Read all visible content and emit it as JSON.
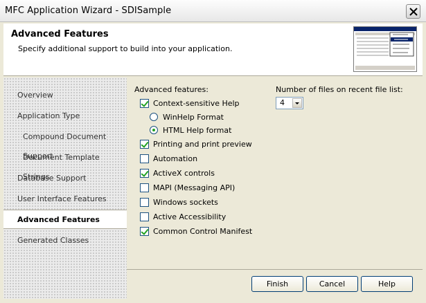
{
  "window": {
    "title": "MFC Application Wizard - SDISample"
  },
  "header": {
    "title": "Advanced Features",
    "subtitle": "Specify additional support to build into your application."
  },
  "nav": {
    "items": [
      {
        "label": "Overview"
      },
      {
        "label": "Application Type"
      },
      {
        "label": "Compound Document Support"
      },
      {
        "label": "Document Template Strings"
      },
      {
        "label": "Database Support"
      },
      {
        "label": "User Interface Features"
      },
      {
        "label": "Advanced Features"
      },
      {
        "label": "Generated Classes"
      }
    ]
  },
  "features": {
    "group_label": "Advanced features:",
    "context_help": {
      "label": "Context-sensitive Help",
      "checked": true
    },
    "winhelp": {
      "label": "WinHelp Format",
      "selected": false
    },
    "htmlhelp": {
      "label": "HTML Help format",
      "selected": true
    },
    "printing": {
      "label": "Printing and print preview",
      "checked": true
    },
    "automation": {
      "label": "Automation",
      "checked": false
    },
    "activex": {
      "label": "ActiveX controls",
      "checked": true
    },
    "mapi": {
      "label": "MAPI (Messaging API)",
      "checked": false
    },
    "sockets": {
      "label": "Windows sockets",
      "checked": false
    },
    "accessibility": {
      "label": "Active Accessibility",
      "checked": false
    },
    "manifest": {
      "label": "Common Control Manifest",
      "checked": true
    }
  },
  "recent_files": {
    "label": "Number of files on recent file list:",
    "value": "4"
  },
  "buttons": {
    "finish": "Finish",
    "cancel": "Cancel",
    "help": "Help"
  }
}
